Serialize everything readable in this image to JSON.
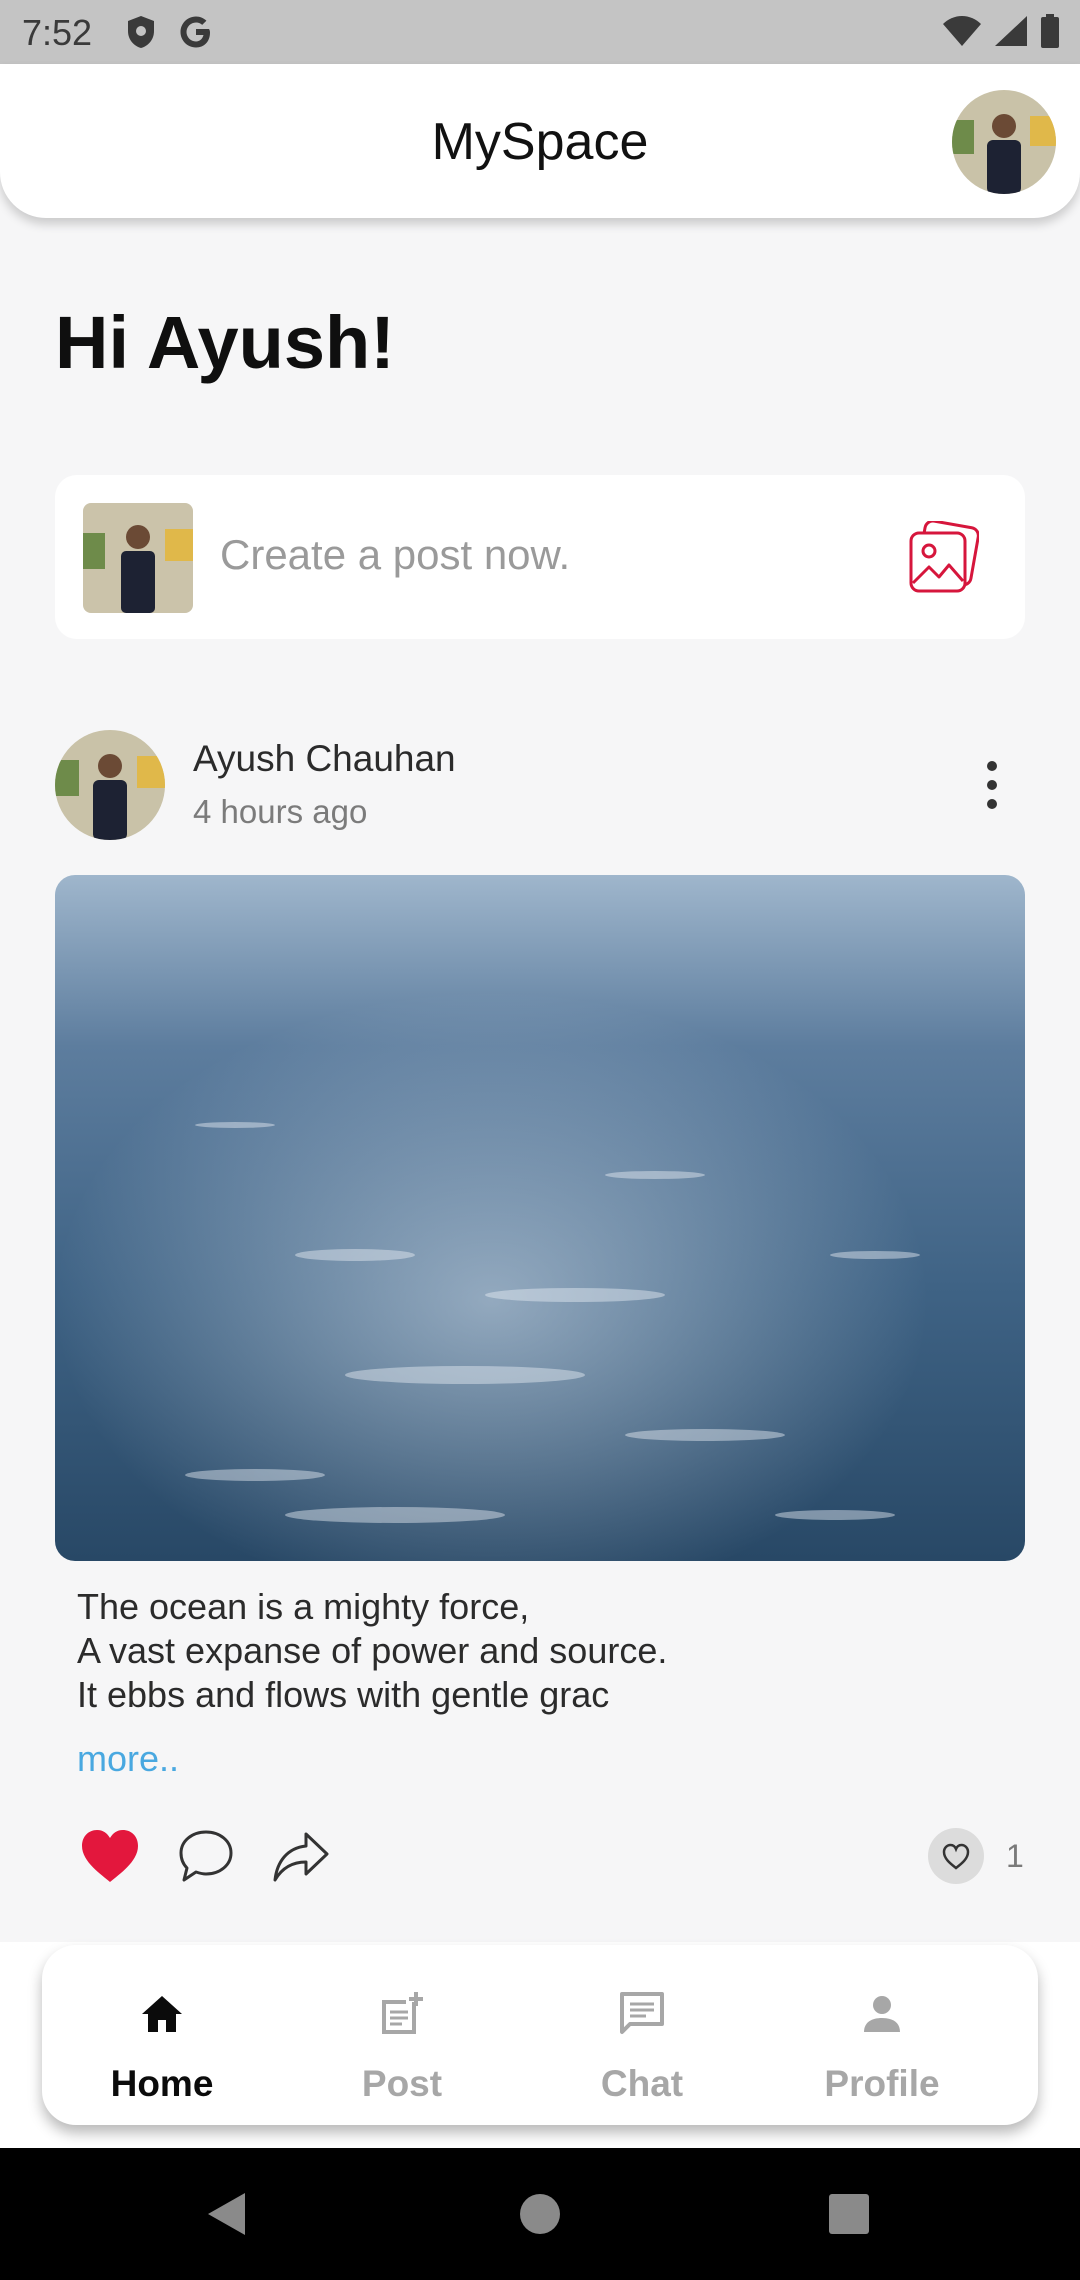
{
  "status_bar": {
    "time": "7:52",
    "left_icons": [
      "shield-icon",
      "google-icon"
    ],
    "right_icons": [
      "wifi-icon",
      "signal-icon",
      "battery-icon"
    ]
  },
  "app_bar": {
    "title": "MySpace",
    "avatar": "profile-avatar"
  },
  "greeting": "Hi Ayush!",
  "create_post": {
    "placeholder": "Create a post now.",
    "icon": "image-picker-icon",
    "accent": "#d6163c"
  },
  "post": {
    "author": "Ayush Chauhan",
    "time": "4 hours ago",
    "menu_icon": "more-vert-icon",
    "caption_lines": [
      "The ocean is a mighty force,",
      "A vast expanse of power and source.",
      "It ebbs and flows with gentle grac"
    ],
    "more_label": "more..",
    "like_count": "1",
    "liked": true,
    "colors": {
      "heart": "#e3173d",
      "link": "#49a8e0"
    }
  },
  "bottom_nav": {
    "items": [
      {
        "label": "Home",
        "icon": "home-icon",
        "active": true
      },
      {
        "label": "Post",
        "icon": "post-add-icon",
        "active": false
      },
      {
        "label": "Chat",
        "icon": "chat-icon",
        "active": false
      },
      {
        "label": "Profile",
        "icon": "person-icon",
        "active": false
      }
    ]
  },
  "system_nav": [
    "back-icon",
    "home-circle-icon",
    "recents-icon"
  ]
}
